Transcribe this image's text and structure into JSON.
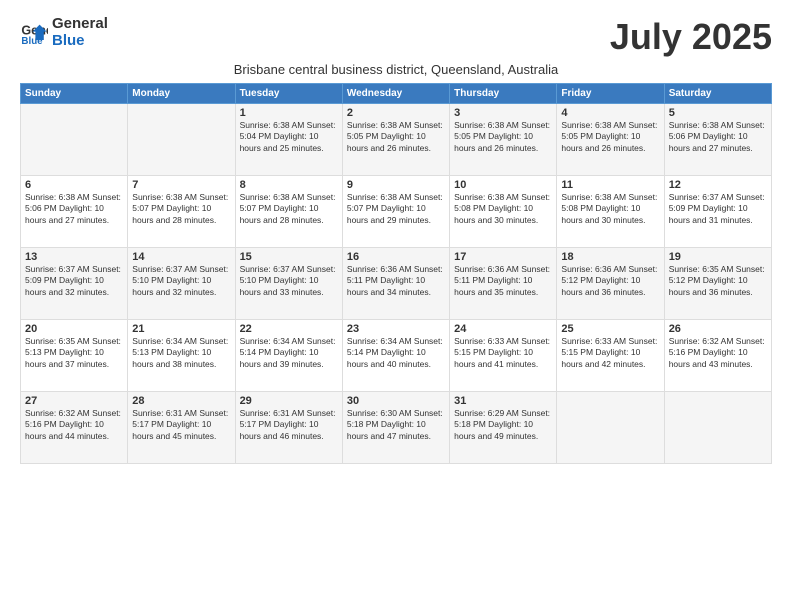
{
  "logo": {
    "line1": "General",
    "line2": "Blue"
  },
  "title": "July 2025",
  "subtitle": "Brisbane central business district, Queensland, Australia",
  "headers": [
    "Sunday",
    "Monday",
    "Tuesday",
    "Wednesday",
    "Thursday",
    "Friday",
    "Saturday"
  ],
  "weeks": [
    [
      {
        "day": "",
        "info": ""
      },
      {
        "day": "",
        "info": ""
      },
      {
        "day": "1",
        "info": "Sunrise: 6:38 AM\nSunset: 5:04 PM\nDaylight: 10 hours\nand 25 minutes."
      },
      {
        "day": "2",
        "info": "Sunrise: 6:38 AM\nSunset: 5:05 PM\nDaylight: 10 hours\nand 26 minutes."
      },
      {
        "day": "3",
        "info": "Sunrise: 6:38 AM\nSunset: 5:05 PM\nDaylight: 10 hours\nand 26 minutes."
      },
      {
        "day": "4",
        "info": "Sunrise: 6:38 AM\nSunset: 5:05 PM\nDaylight: 10 hours\nand 26 minutes."
      },
      {
        "day": "5",
        "info": "Sunrise: 6:38 AM\nSunset: 5:06 PM\nDaylight: 10 hours\nand 27 minutes."
      }
    ],
    [
      {
        "day": "6",
        "info": "Sunrise: 6:38 AM\nSunset: 5:06 PM\nDaylight: 10 hours\nand 27 minutes."
      },
      {
        "day": "7",
        "info": "Sunrise: 6:38 AM\nSunset: 5:07 PM\nDaylight: 10 hours\nand 28 minutes."
      },
      {
        "day": "8",
        "info": "Sunrise: 6:38 AM\nSunset: 5:07 PM\nDaylight: 10 hours\nand 28 minutes."
      },
      {
        "day": "9",
        "info": "Sunrise: 6:38 AM\nSunset: 5:07 PM\nDaylight: 10 hours\nand 29 minutes."
      },
      {
        "day": "10",
        "info": "Sunrise: 6:38 AM\nSunset: 5:08 PM\nDaylight: 10 hours\nand 30 minutes."
      },
      {
        "day": "11",
        "info": "Sunrise: 6:38 AM\nSunset: 5:08 PM\nDaylight: 10 hours\nand 30 minutes."
      },
      {
        "day": "12",
        "info": "Sunrise: 6:37 AM\nSunset: 5:09 PM\nDaylight: 10 hours\nand 31 minutes."
      }
    ],
    [
      {
        "day": "13",
        "info": "Sunrise: 6:37 AM\nSunset: 5:09 PM\nDaylight: 10 hours\nand 32 minutes."
      },
      {
        "day": "14",
        "info": "Sunrise: 6:37 AM\nSunset: 5:10 PM\nDaylight: 10 hours\nand 32 minutes."
      },
      {
        "day": "15",
        "info": "Sunrise: 6:37 AM\nSunset: 5:10 PM\nDaylight: 10 hours\nand 33 minutes."
      },
      {
        "day": "16",
        "info": "Sunrise: 6:36 AM\nSunset: 5:11 PM\nDaylight: 10 hours\nand 34 minutes."
      },
      {
        "day": "17",
        "info": "Sunrise: 6:36 AM\nSunset: 5:11 PM\nDaylight: 10 hours\nand 35 minutes."
      },
      {
        "day": "18",
        "info": "Sunrise: 6:36 AM\nSunset: 5:12 PM\nDaylight: 10 hours\nand 36 minutes."
      },
      {
        "day": "19",
        "info": "Sunrise: 6:35 AM\nSunset: 5:12 PM\nDaylight: 10 hours\nand 36 minutes."
      }
    ],
    [
      {
        "day": "20",
        "info": "Sunrise: 6:35 AM\nSunset: 5:13 PM\nDaylight: 10 hours\nand 37 minutes."
      },
      {
        "day": "21",
        "info": "Sunrise: 6:34 AM\nSunset: 5:13 PM\nDaylight: 10 hours\nand 38 minutes."
      },
      {
        "day": "22",
        "info": "Sunrise: 6:34 AM\nSunset: 5:14 PM\nDaylight: 10 hours\nand 39 minutes."
      },
      {
        "day": "23",
        "info": "Sunrise: 6:34 AM\nSunset: 5:14 PM\nDaylight: 10 hours\nand 40 minutes."
      },
      {
        "day": "24",
        "info": "Sunrise: 6:33 AM\nSunset: 5:15 PM\nDaylight: 10 hours\nand 41 minutes."
      },
      {
        "day": "25",
        "info": "Sunrise: 6:33 AM\nSunset: 5:15 PM\nDaylight: 10 hours\nand 42 minutes."
      },
      {
        "day": "26",
        "info": "Sunrise: 6:32 AM\nSunset: 5:16 PM\nDaylight: 10 hours\nand 43 minutes."
      }
    ],
    [
      {
        "day": "27",
        "info": "Sunrise: 6:32 AM\nSunset: 5:16 PM\nDaylight: 10 hours\nand 44 minutes."
      },
      {
        "day": "28",
        "info": "Sunrise: 6:31 AM\nSunset: 5:17 PM\nDaylight: 10 hours\nand 45 minutes."
      },
      {
        "day": "29",
        "info": "Sunrise: 6:31 AM\nSunset: 5:17 PM\nDaylight: 10 hours\nand 46 minutes."
      },
      {
        "day": "30",
        "info": "Sunrise: 6:30 AM\nSunset: 5:18 PM\nDaylight: 10 hours\nand 47 minutes."
      },
      {
        "day": "31",
        "info": "Sunrise: 6:29 AM\nSunset: 5:18 PM\nDaylight: 10 hours\nand 49 minutes."
      },
      {
        "day": "",
        "info": ""
      },
      {
        "day": "",
        "info": ""
      }
    ]
  ]
}
